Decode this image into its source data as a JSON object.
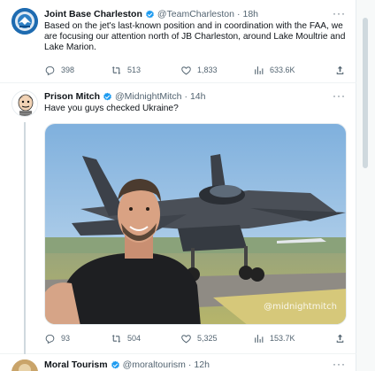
{
  "tweets": [
    {
      "name": "Joint Base Charleston",
      "handle": "@TeamCharleston",
      "time": "18h",
      "text": "Based on the jet's last-known position and in coordination with the FAA, we are focusing our attention north of JB Charleston, around Lake Moultrie and Lake Marion.",
      "replies": "398",
      "retweets": "513",
      "likes": "1,833",
      "views": "633.6K"
    },
    {
      "name": "Prison Mitch",
      "handle": "@MidnightMitch",
      "time": "14h",
      "text": "Have you guys checked Ukraine?",
      "watermark": "@midnightmitch",
      "replies": "93",
      "retweets": "504",
      "likes": "5,325",
      "views": "153.7K"
    },
    {
      "name": "Moral Tourism",
      "handle": "@moraltourism",
      "time": "12h"
    }
  ],
  "ui": {
    "separator": "·",
    "more": "···"
  },
  "colors": {
    "verified_badge": "#1d9bf0",
    "text_primary": "#0f1419",
    "text_secondary": "#536471"
  }
}
